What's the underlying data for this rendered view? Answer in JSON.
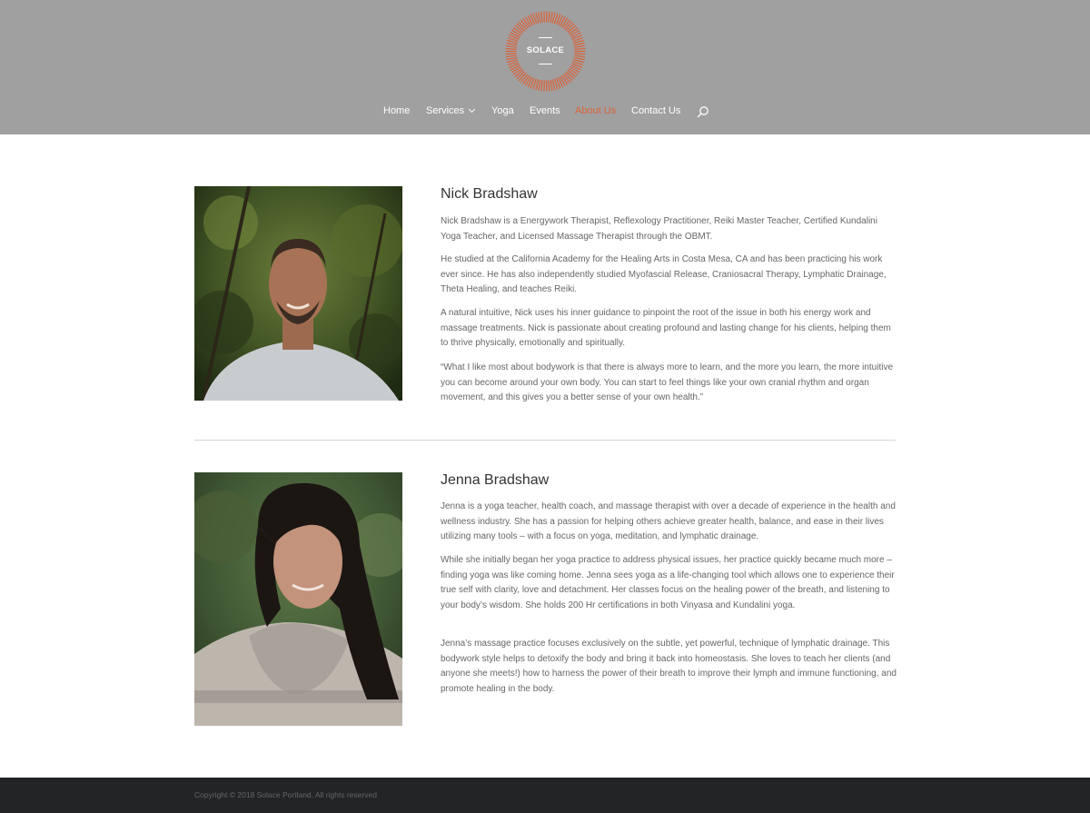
{
  "brand": {
    "name": "SOLACE",
    "accent": "#d9633c"
  },
  "nav": {
    "items": [
      "Home",
      "Services",
      "Yoga",
      "Events",
      "About Us",
      "Contact Us"
    ],
    "active": "About Us"
  },
  "profiles": [
    {
      "name": "Nick Bradshaw",
      "paragraphs": [
        "Nick Bradshaw is a Energywork Therapist, Reflexology Practitioner, Reiki Master Teacher, Certified Kundalini Yoga Teacher, and Licensed Massage Therapist through the OBMT.",
        "He studied at the California Academy for the Healing Arts in Costa Mesa, CA and has been practicing his work ever since. He has also independently studied Myofascial Release, Craniosacral Therapy, Lymphatic Drainage, Theta Healing, and teaches Reiki.",
        "A natural intuitive, Nick uses his inner guidance to pinpoint the root of the issue in both his energy work and massage treatments. Nick is passionate about creating profound and lasting change for his clients, helping them to thrive physically, emotionally and spiritually.",
        "“What I like most about bodywork is that there is always more to learn, and the more you learn, the more intuitive you can become around your own body. You can start to feel things like your own cranial rhythm and organ movement, and this gives you a better sense of your own health.”"
      ]
    },
    {
      "name": "Jenna Bradshaw",
      "paragraphs": [
        "Jenna is a yoga teacher, health coach, and massage therapist with over a decade of experience in the health and wellness industry. She has a passion for helping others achieve greater health, balance, and ease in their lives utilizing many tools – with a focus on yoga, meditation, and lymphatic drainage.",
        "While she initially began her yoga practice to address physical issues, her practice quickly became much more – finding yoga was like coming home. Jenna sees yoga as a life-changing tool which allows one to experience their true self with clarity, love and detachment. Her classes focus on the healing power of the breath, and listening to your body’s wisdom. She holds 200 Hr certifications in both Vinyasa and Kundalini yoga.",
        "Jenna’s massage practice focuses exclusively on the subtle, yet powerful, technique of lymphatic drainage. This bodywork style helps to detoxify the body and bring it back into homeostasis. She loves to teach her clients (and anyone she meets!) how to harness the power of their breath to improve their lymph and immune functioning, and promote healing in the body."
      ]
    }
  ],
  "footer": {
    "copyright": "Copyright © 2018 Solace Portland. All rights reserved"
  }
}
